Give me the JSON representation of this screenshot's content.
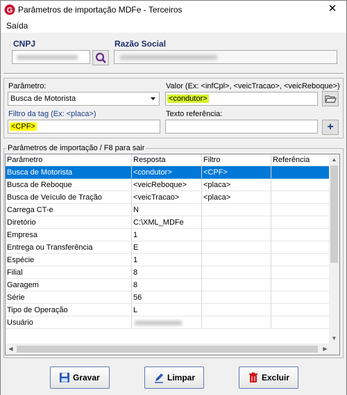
{
  "window": {
    "title": "Parâmetros de importação MDFe - Terceiros",
    "close_glyph": "✕"
  },
  "menu": {
    "items": [
      {
        "label": "Saída"
      }
    ]
  },
  "header": {
    "cnpj_label": "CNPJ",
    "razao_social_label": "Razão Social"
  },
  "form": {
    "parametro_label": "Parâmetro:",
    "parametro_value": "Busca de Motorista",
    "valor_label": "Valor (Ex: <infCpl>, <veicTracao>, <veicReboque>)",
    "valor_value": "<condutor>",
    "filtro_label": "Filtro da tag (Ex: <placa>)",
    "filtro_value": "<CPF>",
    "texto_label": "Texto referência:",
    "texto_value": ""
  },
  "grid": {
    "title": "Parâmetros de importação /  F8 para sair",
    "columns": [
      "Parâmetro",
      "Resposta",
      "Filtro",
      "Referência"
    ],
    "rows": [
      [
        "Busca de Motorista",
        "<condutor>",
        "<CPF>",
        ""
      ],
      [
        "Busca de Reboque",
        "<veicReboque>",
        "<placa>",
        ""
      ],
      [
        "Busca de Veículo de Tração",
        "<veicTracao>",
        "<placa>",
        ""
      ],
      [
        "Carrega CT-e",
        "N",
        "",
        ""
      ],
      [
        "Diretório",
        "C:\\XML_MDFe",
        "",
        ""
      ],
      [
        "Empresa",
        "1",
        "",
        ""
      ],
      [
        "Entrega ou Transferência",
        "E",
        "",
        ""
      ],
      [
        "Espécie",
        "1",
        "",
        ""
      ],
      [
        "Filial",
        "8",
        "",
        ""
      ],
      [
        "Garagem",
        "8",
        "",
        ""
      ],
      [
        "Série",
        "56",
        "",
        ""
      ],
      [
        "Tipo de Operação",
        "L",
        "",
        ""
      ],
      [
        "Usuário",
        "",
        "",
        ""
      ]
    ],
    "selected_row": 0
  },
  "actions": {
    "gravar": "Gravar",
    "limpar": "Limpar",
    "excluir": "Excluir"
  },
  "colors": {
    "selection": "#0078d7",
    "highlight_green": "#d8f52a",
    "highlight_yellow": "#ffff00",
    "label_blue": "#1a3c8c"
  }
}
